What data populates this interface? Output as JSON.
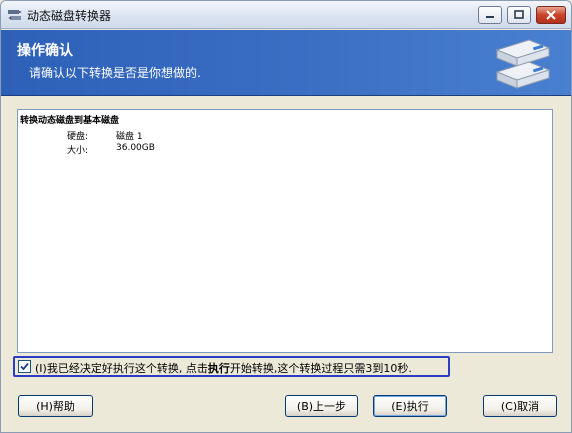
{
  "window": {
    "title": "动态磁盘转换器",
    "controls": {
      "minimize": "minimize",
      "maximize": "maximize",
      "close": "close"
    }
  },
  "banner": {
    "title": "操作确认",
    "subtitle": "请确认以下转换是否是你想做的."
  },
  "content": {
    "heading": "转换动态磁盘到基本磁盘",
    "rows": [
      {
        "label": "硬盘:",
        "value": "磁盘 1"
      },
      {
        "label": "大小:",
        "value": "36.00GB"
      }
    ]
  },
  "confirm": {
    "checked": true,
    "prefix": "(I)我已经决定好执行这个转换, 点击",
    "bold": "执行",
    "suffix": "开始转换,这个转换过程只需3到10秒."
  },
  "buttons": {
    "help": "(H)帮助",
    "back": "(B)上一步",
    "run": "(E)执行",
    "cancel": "(C)取消"
  },
  "colors": {
    "banner": "#2d60b7",
    "confirm_border": "#2a3dc4",
    "button_border": "#003c74"
  }
}
